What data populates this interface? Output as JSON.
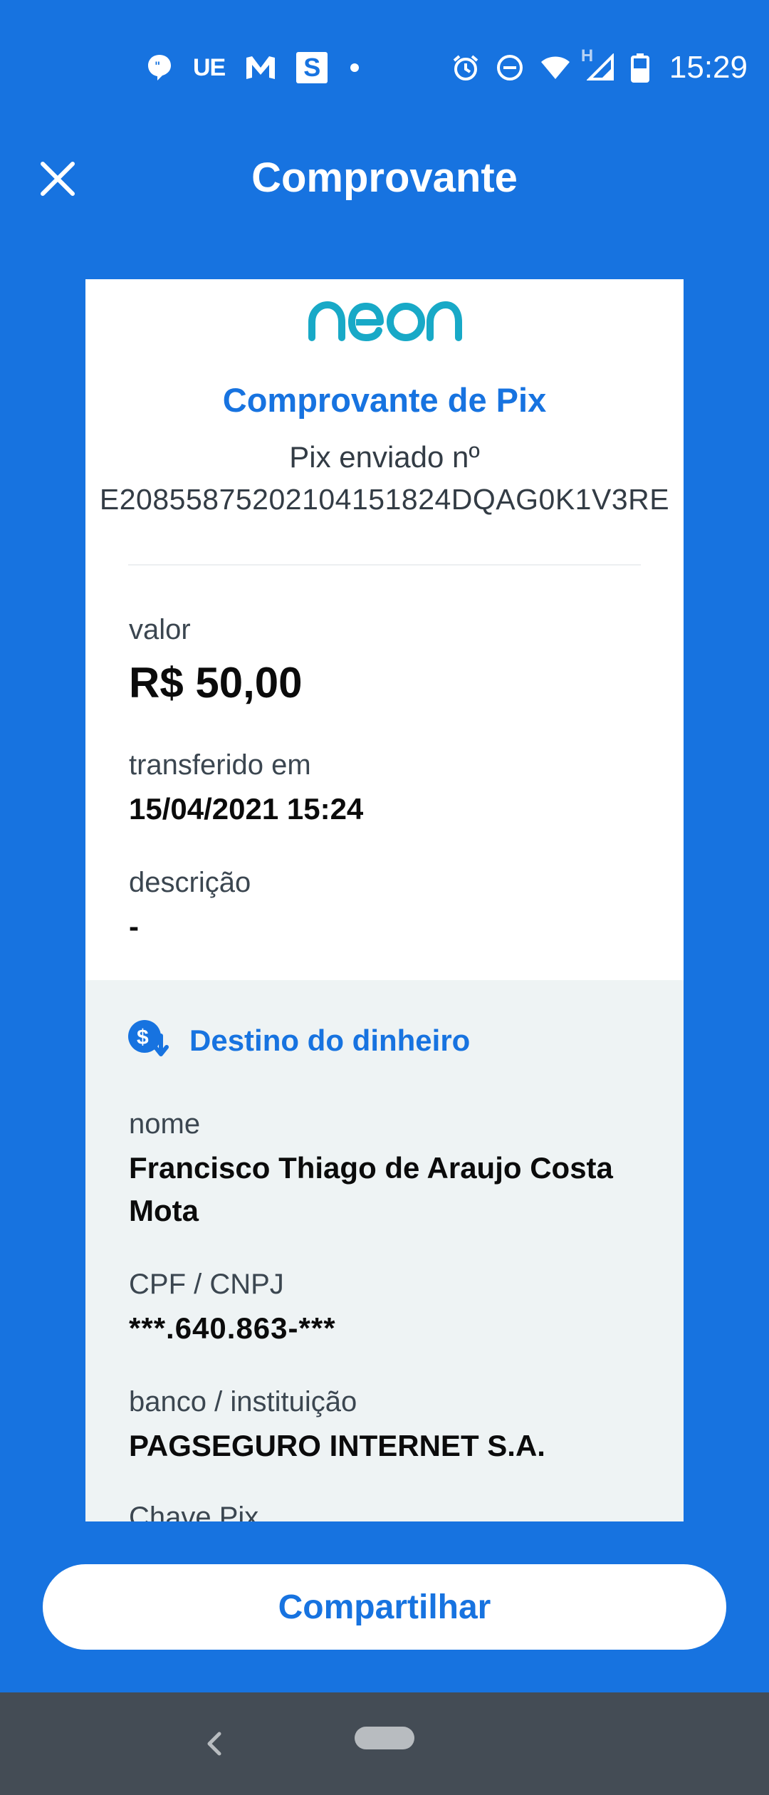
{
  "status_bar": {
    "carrier_text": "UE",
    "s_badge": "S",
    "time": "15:29",
    "network_type": "H",
    "icons": [
      "message-icon",
      "ue-text",
      "m-icon",
      "s-badge-icon",
      "dot-icon",
      "alarm-icon",
      "dnd-icon",
      "wifi-icon",
      "signal-icon",
      "battery-icon"
    ]
  },
  "header": {
    "title": "Comprovante",
    "close_icon": "close-icon"
  },
  "receipt": {
    "brand": "neon",
    "title": "Comprovante de Pix",
    "pix_label": "Pix enviado nº",
    "pix_id": "E20855875202104151824DQAG0K1V3RE",
    "fields": {
      "valor_label": "valor",
      "valor_value": "R$ 50,00",
      "transferido_label": "transferido em",
      "transferido_value": "15/04/2021 15:24",
      "descricao_label": "descrição",
      "descricao_value": "-"
    },
    "destino": {
      "title": "Destino do dinheiro",
      "icon": "money-destination-icon",
      "nome_label": "nome",
      "nome_value_line1": "Francisco Thiago de Araujo Costa",
      "nome_value_line2": "Mota",
      "cpf_label": "CPF / CNPJ",
      "cpf_value": "***.640.863-***",
      "banco_label": "banco / instituição",
      "banco_value": "PAGSEGURO INTERNET S.A.",
      "chave_label": "Chave Pix"
    }
  },
  "actions": {
    "share_label": "Compartilhar"
  },
  "colors": {
    "primary": "#1773E0",
    "teal": "#18A9C7",
    "section_bg": "#EEF3F4",
    "nav_bg": "#444C55"
  }
}
